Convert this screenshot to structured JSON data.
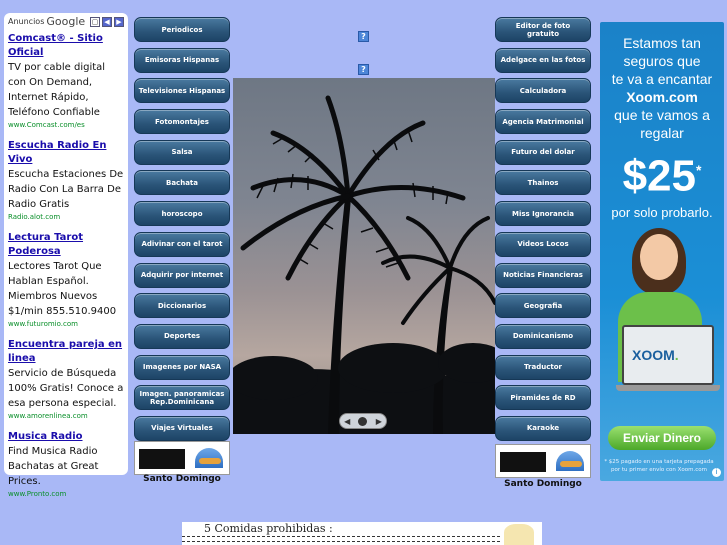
{
  "ads": {
    "header_label": "Anuncios",
    "header_brand": "Google",
    "items": [
      {
        "title": "Comcast® - Sitio Oficial",
        "desc": "TV por cable digital con On Demand, Internet Rápido, Teléfono Confiable",
        "url": "www.Comcast.com/es"
      },
      {
        "title": "Escucha Radio En Vivo",
        "desc": "Escucha Estaciones De Radio Con La Barra De Radio Gratis",
        "url": "Radio.alot.com"
      },
      {
        "title": "Lectura Tarot Poderosa",
        "desc": "Lectores Tarot Que Hablan Español. Miembros Nuevos $1/min 855.510.9400",
        "url": "www.futuromio.com"
      },
      {
        "title": "Encuentra pareja en linea",
        "desc": "Servicio de Búsqueda 100% Gratis! Conoce a esa persona especial.",
        "url": "www.amorenlinea.com"
      },
      {
        "title": "Musica Radio",
        "desc": "Find Musica Radio Bachatas at Great Prices.",
        "url": "www.Pronto.com"
      }
    ]
  },
  "nav_left": [
    {
      "label": "Periodicos"
    },
    {
      "label": "Emisoras Hispanas"
    },
    {
      "label": "Televisiones Hispanas"
    },
    {
      "label": "Fotomontajes"
    },
    {
      "label": "Salsa"
    },
    {
      "label": "Bachata"
    },
    {
      "label": "horoscopo"
    },
    {
      "label": "Adivinar con el tarot"
    },
    {
      "label": "Adquirir por internet"
    },
    {
      "label": "Diccionarios"
    },
    {
      "label": "Deportes"
    },
    {
      "label": "Imagenes por NASA"
    },
    {
      "label": "Imagen. panoramicas Rep.Dominicana"
    },
    {
      "label": "Viajes Virtuales"
    }
  ],
  "nav_right": [
    {
      "label": "Editor de foto gratuito"
    },
    {
      "label": "Adelgace en las fotos"
    },
    {
      "label": "Calculadora"
    },
    {
      "label": "Agencia Matrimonial"
    },
    {
      "label": "Futuro del dolar"
    },
    {
      "label": "Thainos"
    },
    {
      "label": "Miss Ignorancia"
    },
    {
      "label": "Videos Locos"
    },
    {
      "label": "Noticias Financieras"
    },
    {
      "label": "Geografia"
    },
    {
      "label": "Dominicanismo"
    },
    {
      "label": "Traductor"
    },
    {
      "label": "Piramides de RD"
    },
    {
      "label": "Karaoke"
    }
  ],
  "weather": {
    "left_city": "Santo Domingo",
    "right_city": "Santo Domingo"
  },
  "help_icon_text": "?",
  "banner": {
    "line1": "Estamos tan",
    "line2": "seguros que",
    "line3": "te va a encantar",
    "line4": "Xoom.com",
    "line5": "que te vamos a",
    "line6": "regalar",
    "price": "$25",
    "price_mark": "*",
    "sub": "por solo probarlo.",
    "laptop_logo_a": "XOOM",
    "laptop_logo_b": ".",
    "button": "Enviar Dinero",
    "fine": "* $25 pagado en una tarjeta prepagada por tu primer envío con Xoom.com",
    "info": "i"
  },
  "bottom": {
    "text": "5 Comidas prohibidas :"
  },
  "colors": {
    "page_bg": "#a9b8f6",
    "nav_btn": "#2a5478",
    "banner_bg": "#1b82c8",
    "ad_title": "#1a0dab",
    "ad_url": "#0a8f2a"
  }
}
